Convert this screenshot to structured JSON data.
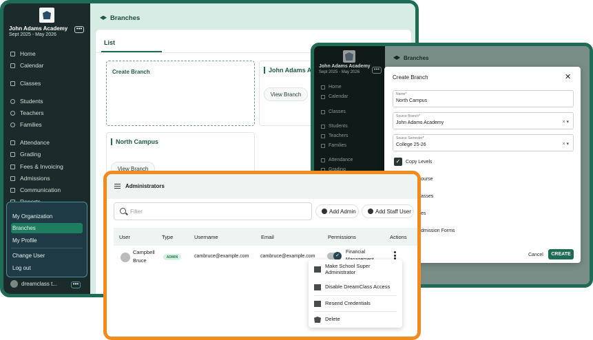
{
  "back_window": {
    "school_name": "John Adams Academy",
    "school_term": "Sept 2025 - May 2026",
    "more_label": "•••",
    "nav": [
      "Home",
      "Calendar",
      "Classes",
      "Students",
      "Teachers",
      "Families",
      "Attendance",
      "Grading",
      "Fees & Invoicing",
      "Admissions",
      "Communication",
      "Reports"
    ],
    "org_menu": [
      "My Organization",
      "Branches",
      "My Profile",
      "Change User",
      "Log out"
    ],
    "footer_user": "dreamclass t...",
    "page_title": "Branches",
    "tab": "List",
    "create_card": "Create Branch",
    "branch_cards": [
      {
        "title": "John Adams Acad",
        "button": "View Branch"
      },
      {
        "title": "North Campus",
        "button": "View Branch"
      }
    ]
  },
  "modal_window": {
    "school_name": "John Adams Academy",
    "school_term": "Sept 2025 - May 2026",
    "more_label": "•••",
    "nav": [
      "Home",
      "Calendar",
      "Classes",
      "Students",
      "Teachers",
      "Families",
      "Attendance",
      "Grading"
    ],
    "page_title": "Branches",
    "dialog": {
      "title": "Create Branch",
      "name_label": "Name*",
      "name_value": "North Campus",
      "source_branch_label": "Source Branch*",
      "source_branch_value": "John Adams Academy",
      "source_semester_label": "Source Semester*",
      "source_semester_value": "College 25-26",
      "clear_glyph": "×",
      "dropdown_glyph": "▾",
      "copy_levels": "Copy Levels",
      "partial_options": [
        "ourse",
        "asses",
        "es",
        "dmission Forms"
      ],
      "cancel": "Cancel",
      "create": "CREATE"
    }
  },
  "admin_window": {
    "title": "Administrators",
    "filter_placeholder": "Filter",
    "add_admin": "Add Admin",
    "add_staff_user": "Add Staff User",
    "columns": [
      "User",
      "Type",
      "Username",
      "Email",
      "Permissions",
      "Actions"
    ],
    "row": {
      "user_first": "Campbell",
      "user_last": "Bruce",
      "type": "ADMIN",
      "username": "cambruce@example.com",
      "email": "cambruce@example.com",
      "permission_line1": "Financial",
      "permission_line2": "Management"
    },
    "actions_menu": [
      {
        "line1": "Make School Super",
        "line2": "Administrator"
      },
      {
        "line1": "Disable DreamClass Access"
      },
      {
        "line1": "Resend Credentials"
      },
      {
        "line1": "Delete"
      }
    ]
  }
}
